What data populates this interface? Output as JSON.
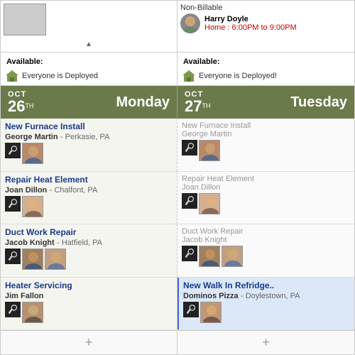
{
  "header": {
    "tab_label": "▼"
  },
  "top_right": {
    "non_billable": "Non-Billable",
    "person_name": "Harry Doyle",
    "person_time_label": "Home :",
    "person_time_value": "6:00PM to 9:00PM"
  },
  "left_available": {
    "label": "Available:",
    "status": "Everyone is Deployed"
  },
  "right_available": {
    "label": "Available:",
    "status": "Everyone is Deployed!"
  },
  "calendar": {
    "left": {
      "month": "OCT",
      "day": "26",
      "suffix": "TH",
      "day_name": "Monday"
    },
    "right": {
      "month": "OCT",
      "day": "27",
      "suffix": "TH",
      "day_name": "Tuesday"
    }
  },
  "jobs": [
    {
      "left_title": "New Furnace Install",
      "left_person": "George Martin",
      "left_location": "Perkasie, PA",
      "right_title": "New Furnace Install",
      "right_person": "George Martin",
      "has_avatars_left": true,
      "has_avatars_right": true
    },
    {
      "left_title": "Repair Heat Element",
      "left_person": "Joan Dillon",
      "left_location": "Chalfont, PA",
      "right_title": "Repair Heat Element",
      "right_person": "Joan Dillon",
      "has_avatars_left": true,
      "has_avatars_right": true
    },
    {
      "left_title": "Duct Work Repair",
      "left_person": "Jacob Knight",
      "left_location": "Hatfield, PA",
      "right_title": "Duct Work Repair",
      "right_person": "Jacob Knight",
      "has_avatars_left": true,
      "has_avatars_right": true
    },
    {
      "left_title": "Heater Servicing",
      "left_person": "Jim Fallon",
      "left_location": "",
      "right_title": "New Walk In Refridge..",
      "right_person": "Dominos Pizza",
      "right_location": "Doylestown, PA",
      "has_avatars_left": true,
      "has_avatars_right": true,
      "right_highlighted": true
    }
  ],
  "add_buttons": {
    "left": "+",
    "right": "+"
  }
}
